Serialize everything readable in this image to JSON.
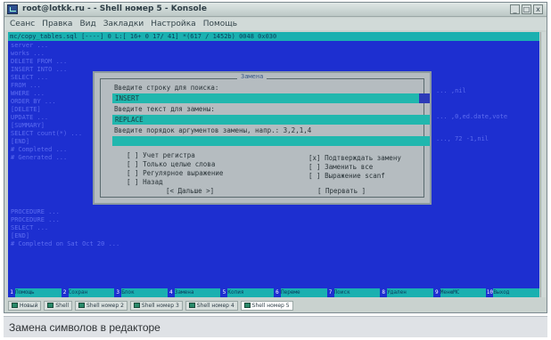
{
  "window": {
    "title": "root@lotkk.ru - - Shell номер 5 - Konsole",
    "controls": [
      "_",
      "□",
      "x"
    ]
  },
  "menubar": [
    "Сеанс",
    "Правка",
    "Вид",
    "Закладки",
    "Настройка",
    "Помощь"
  ],
  "editor": {
    "status_line": "mc/copy_tables.sql   [----]  0 L:[ 16+ 0  17/ 41] *(617 / 1452b) 0048 0x030",
    "lines": [
      "server ...",
      "works ...",
      "DELETE FROM ...",
      "INSERT INTO ...",
      "SELECT ...",
      "FROM ...",
      "WHERE ...",
      "ORDER BY ...",
      "[DELETE]",
      "UPDATE ...",
      "[SUMMARY]",
      "SELECT count(*) ...",
      "[END]",
      "# Completed ...",
      "# Generated ...",
      "",
      "PROCEDURE ...",
      "PROCEDURE ...",
      "SELECT ...",
      "[END]",
      "# Completed on Sat Oct 20 ..."
    ],
    "right_fragments": [
      "... ,nil",
      "... ,0,ed.date,vote",
      "..., 72 -1,nil"
    ]
  },
  "dialog": {
    "title": "Замена",
    "search_label": "Введите строку для поиска:",
    "search_value": "INSERT",
    "replace_label": "Введите текст для замены:",
    "replace_value": "REPLACE",
    "args_label": "Введите порядок аргументов замены, напр.: 3,2,1,4",
    "args_value": "",
    "options_left": [
      {
        "mark": "[ ]",
        "label": "Учет регистра"
      },
      {
        "mark": "[ ]",
        "label": "Только целые слова"
      },
      {
        "mark": "[ ]",
        "label": "Регулярное выражение"
      },
      {
        "mark": "[ ]",
        "label": "Назад"
      }
    ],
    "options_right": [
      {
        "mark": "[x]",
        "label": "Подтверждать замену"
      },
      {
        "mark": "[ ]",
        "label": "Заменить все"
      },
      {
        "mark": "[ ]",
        "label": "Выражение scanf"
      }
    ],
    "ok_button": "[< Дальше >]",
    "cancel_button": "[ Прервать ]"
  },
  "fkeys": [
    {
      "num": "1",
      "label": "Помощь"
    },
    {
      "num": "2",
      "label": "Сохран"
    },
    {
      "num": "3",
      "label": "Блок"
    },
    {
      "num": "4",
      "label": "Замена"
    },
    {
      "num": "5",
      "label": "Копия"
    },
    {
      "num": "6",
      "label": "Переме"
    },
    {
      "num": "7",
      "label": "Поиск"
    },
    {
      "num": "8",
      "label": "Удален"
    },
    {
      "num": "9",
      "label": "МенюMC"
    },
    {
      "num": "10",
      "label": "Выход"
    }
  ],
  "tabs": [
    {
      "label": "Новый"
    },
    {
      "label": "Shell"
    },
    {
      "label": "Shell номер 2"
    },
    {
      "label": "Shell номер 3"
    },
    {
      "label": "Shell номер 4"
    },
    {
      "label": "Shell номер 5",
      "active": true
    }
  ],
  "caption": "Замена символов в редакторе",
  "colors": {
    "terminal_bg": "#1d2fd0",
    "dialog_bg": "#b5bcc0",
    "input_bg": "#21b7ae"
  }
}
